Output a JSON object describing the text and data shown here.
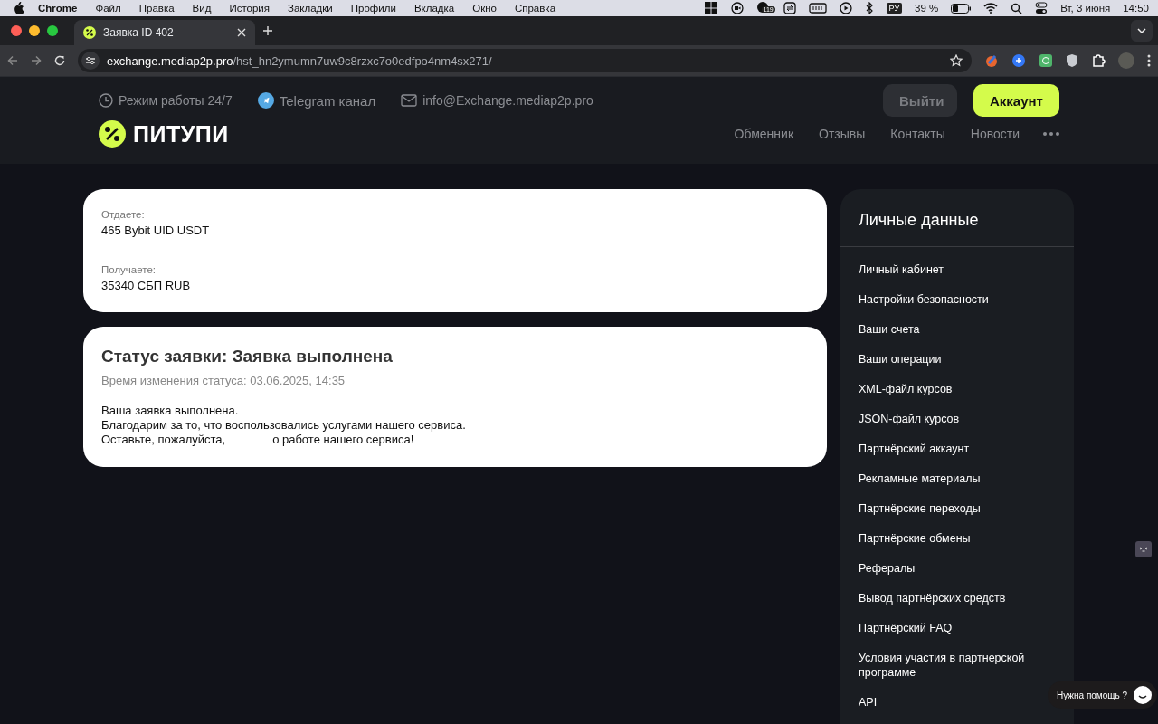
{
  "menubar": {
    "app": "Chrome",
    "items": [
      "Файл",
      "Правка",
      "Вид",
      "История",
      "Закладки",
      "Профили",
      "Вкладка",
      "Окно",
      "Справка"
    ],
    "status": {
      "badge": "119",
      "keyboard": "РУ",
      "battery": "39 %",
      "date": "Вт, 3 июня",
      "time": "14:50"
    }
  },
  "browser": {
    "tabs": [
      {
        "title": "Заявка ID 402",
        "selected": true
      }
    ],
    "url": {
      "host": "exchange.mediap2p.pro",
      "path": "/hst_hn2ymumn7uw9c8rzxc7o0edfpo4nm4sx271/"
    }
  },
  "header": {
    "contacts": [
      {
        "kind": "clock",
        "text": "Режим работы 24/7"
      },
      {
        "kind": "telegram",
        "text": "Telegram канал"
      },
      {
        "kind": "mail",
        "text": "info@Exchange.mediap2p.pro"
      }
    ],
    "buttons": [
      {
        "label": "Выйти",
        "kind": "secondary"
      },
      {
        "label": "Аккаунт",
        "kind": "primary"
      }
    ],
    "logo": "ПИТУПИ",
    "nav": [
      "Обменник",
      "Отзывы",
      "Контакты",
      "Новости"
    ]
  },
  "exchange": [
    {
      "label": "Отдаете:",
      "value": "465 Bybit UID USDT"
    },
    {
      "label": "Получаете:",
      "value": "35340 СБП RUB"
    }
  ],
  "status": {
    "title": "Статус заявки: Заявка выполнена",
    "time": "Время изменения статуса: 03.06.2025, 14:35",
    "lines": [
      "Ваша заявка выполнена.",
      "Благодарим за то, что воспользовались услугами нашего сервиса."
    ],
    "last_line": [
      "Оставьте, пожалуйста,",
      "о работе нашего сервиса!"
    ]
  },
  "sidebar": {
    "title": "Личные данные",
    "items": [
      "Личный кабинет",
      "Настройки безопасности",
      "Ваши счета",
      "Ваши операции",
      "XML-файл курсов",
      "JSON-файл курсов",
      "Партнёрский аккаунт",
      "Рекламные материалы",
      "Партнёрские переходы",
      "Партнёрские обмены",
      "Рефералы",
      "Вывод партнёрских средств",
      "Партнёрский FAQ",
      "Условия участия в партнерской программе",
      "API"
    ]
  },
  "help": {
    "label": "Нужна помощь ?"
  }
}
